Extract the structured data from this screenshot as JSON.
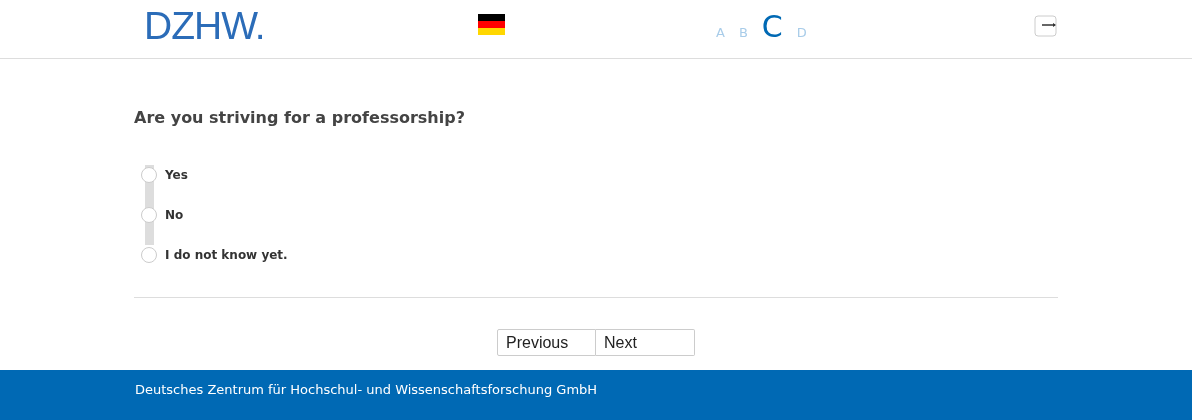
{
  "logo": "DZHW.",
  "chapters": [
    {
      "label": "A",
      "selected": false
    },
    {
      "label": "B",
      "selected": false
    },
    {
      "label": "C",
      "selected": true
    },
    {
      "label": "D",
      "selected": false
    }
  ],
  "question": "Are you striving for a professorship?",
  "options": [
    {
      "label": "Yes",
      "selected": false
    },
    {
      "label": "No",
      "selected": false
    },
    {
      "label": "I do not know yet.",
      "selected": false
    }
  ],
  "buttons": [
    "Previous",
    "Next"
  ],
  "footer": "Deutsches Zentrum für Hochschul- und Wissenschaftsforschung GmbH"
}
